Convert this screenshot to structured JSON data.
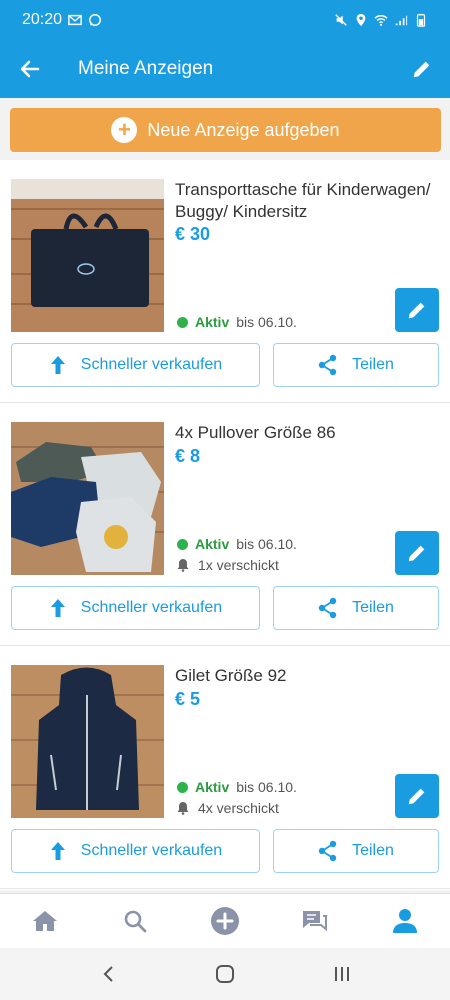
{
  "statusbar": {
    "time": "20:20"
  },
  "header": {
    "title": "Meine Anzeigen"
  },
  "new_ad": {
    "label": "Neue Anzeige aufgeben"
  },
  "ads": [
    {
      "title": "Transporttasche für Kinderwagen/ Buggy/ Kindersitz",
      "price": "€ 30",
      "status": "Aktiv",
      "until": "bis 06.10.",
      "sent": ""
    },
    {
      "title": "4x Pullover Größe 86",
      "price": "€ 8",
      "status": "Aktiv",
      "until": "bis 06.10.",
      "sent": "1x verschickt"
    },
    {
      "title": "Gilet Größe 92",
      "price": "€ 5",
      "status": "Aktiv",
      "until": "bis 06.10.",
      "sent": "4x verschickt"
    }
  ],
  "actions": {
    "sell_faster": "Schneller verkaufen",
    "share": "Teilen"
  },
  "colors": {
    "brand": "#1a9ce0",
    "accent": "#f0a54a",
    "active": "#2db34a"
  },
  "bottom_nav": [
    "home-icon",
    "search-icon",
    "add-icon",
    "messages-icon",
    "profile-icon"
  ]
}
